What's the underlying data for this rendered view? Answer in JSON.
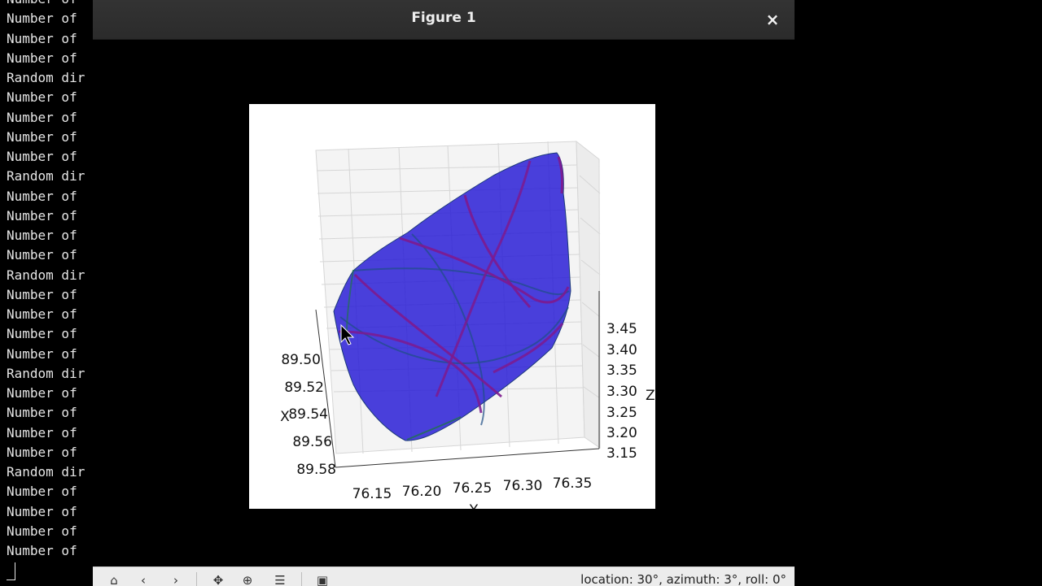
{
  "terminal": {
    "lines": [
      "Number of",
      "Number of",
      "Number of",
      "Number of",
      "Random dir",
      "Number of",
      "Number of",
      "Number of",
      "Number of",
      "Random dir",
      "Number of",
      "Number of",
      "Number of",
      "Number of",
      "Random dir",
      "Number of",
      "Number of",
      "Number of",
      "Number of",
      "Random dir",
      "Number of",
      "Number of",
      "Number of",
      "Number of",
      "Random dir",
      "Number of",
      "Number of",
      "Number of",
      "Number of"
    ]
  },
  "window": {
    "title": "Figure 1",
    "close_glyph": "×"
  },
  "plot": {
    "x_axis_letter": "X",
    "y_axis_letter": "Y",
    "z_axis_letter": "Z",
    "x_ticks": [
      "89.50",
      "89.52",
      "89.54",
      "89.56",
      "89.58"
    ],
    "y_ticks": [
      "76.15",
      "76.20",
      "76.25",
      "76.30",
      "76.35"
    ],
    "z_ticks": [
      "3.45",
      "3.40",
      "3.35",
      "3.30",
      "3.25",
      "3.20",
      "3.15"
    ],
    "colors": {
      "hull_fill": "#2a1fd6",
      "edge_purple": "#7d1a8e",
      "edge_teal": "#1f4f86",
      "edge_green": "#1b7a3a"
    }
  },
  "toolbar": {
    "home_icon": "home-icon",
    "back_icon": "back-arrow-icon",
    "forward_icon": "forward-arrow-icon",
    "pan_icon": "pan-icon",
    "zoom_icon": "zoom-icon",
    "subplots_icon": "subplots-icon",
    "save_icon": "save-icon",
    "status_text": "location: 30°, azimuth: 3°, roll: 0°"
  }
}
